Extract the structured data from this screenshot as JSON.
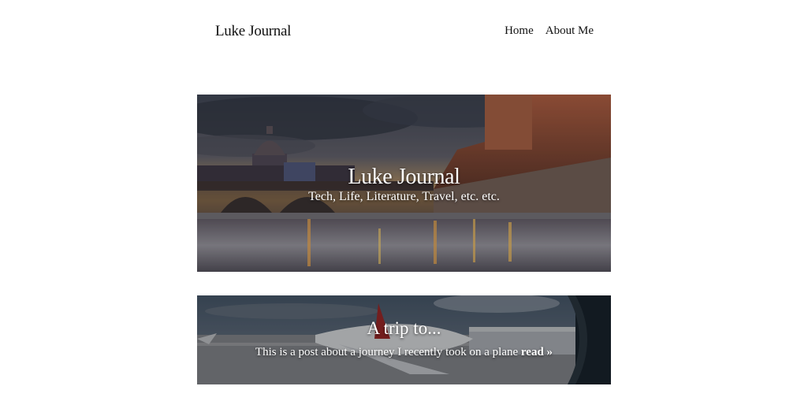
{
  "header": {
    "site_title": "Luke Journal",
    "nav": [
      {
        "label": "Home"
      },
      {
        "label": "About Me"
      }
    ]
  },
  "hero": {
    "title": "Luke Journal",
    "subtitle": "Tech, Life, Literature, Travel, etc. etc."
  },
  "posts": [
    {
      "title": "A trip to...",
      "excerpt": "This is a post about a journey I recently took on a plane",
      "read_more": "read »"
    }
  ]
}
